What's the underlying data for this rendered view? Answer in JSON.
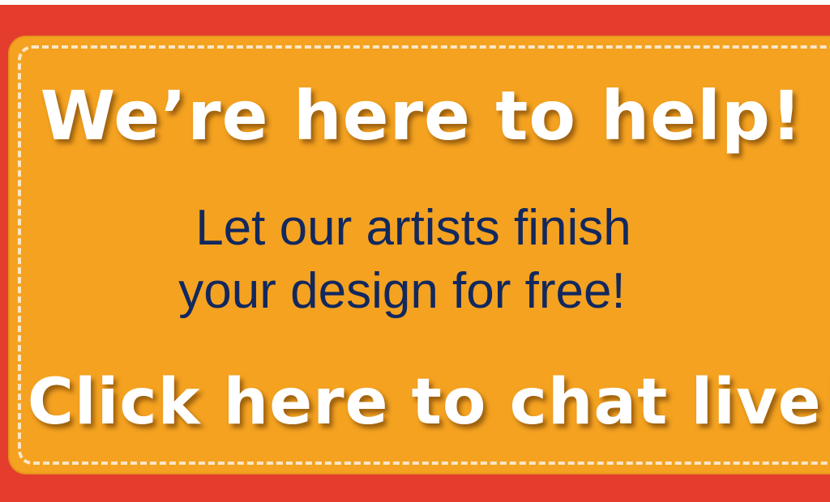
{
  "banner": {
    "headline": "We’re here to help!",
    "subline_1": "Let our artists finish",
    "subline_2": "your design for free!",
    "cta": "Click here to chat live!"
  },
  "colors": {
    "frame_red": "#e43d2e",
    "panel_orange": "#f4a220",
    "dash_cream": "#fbe6c6",
    "text_navy": "#12285e",
    "text_white": "#ffffff"
  }
}
